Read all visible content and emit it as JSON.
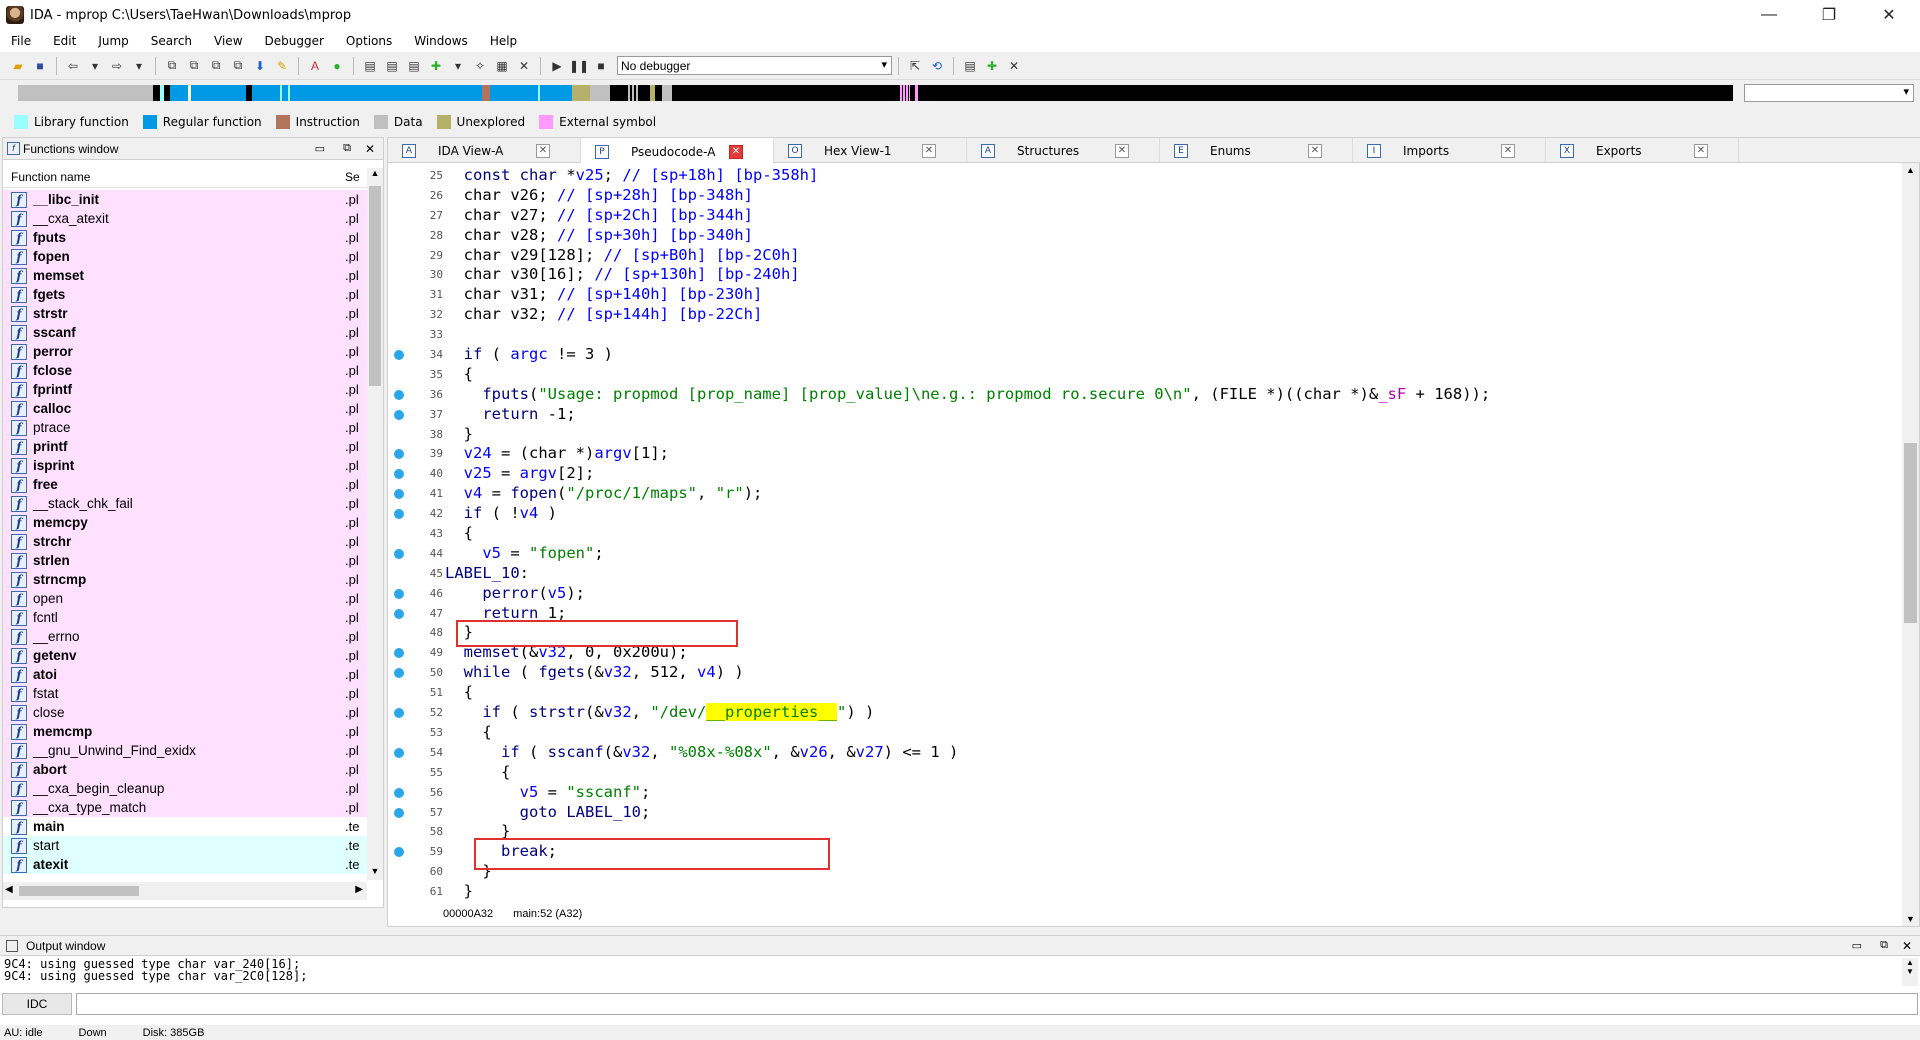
{
  "window": {
    "title": "IDA - mprop C:\\Users\\TaeHwan\\Downloads\\mprop",
    "minimize": "—",
    "restore": "❐",
    "close": "✕"
  },
  "menu": [
    "File",
    "Edit",
    "Jump",
    "Search",
    "View",
    "Debugger",
    "Options",
    "Windows",
    "Help"
  ],
  "toolbar": {
    "debugger_select": "No debugger"
  },
  "legend": [
    {
      "label": "Library function",
      "color": "#99ffff"
    },
    {
      "label": "Regular function",
      "color": "#0099e6"
    },
    {
      "label": "Instruction",
      "color": "#b0755a"
    },
    {
      "label": "Data",
      "color": "#c0c0c0"
    },
    {
      "label": "Unexplored",
      "color": "#b5b06a"
    },
    {
      "label": "External symbol",
      "color": "#ff99ff"
    }
  ],
  "functions_window": {
    "title": "Functions window",
    "col_name": "Function name",
    "col_segment": "Se",
    "rows": [
      {
        "name": "__libc_init",
        "seg": ".pl",
        "bg": "#ffe0ff",
        "bold": true
      },
      {
        "name": "__cxa_atexit",
        "seg": ".pl",
        "bg": "#ffe0ff",
        "bold": false
      },
      {
        "name": "fputs",
        "seg": ".pl",
        "bg": "#ffe0ff",
        "bold": true
      },
      {
        "name": "fopen",
        "seg": ".pl",
        "bg": "#ffe0ff",
        "bold": true
      },
      {
        "name": "memset",
        "seg": ".pl",
        "bg": "#ffe0ff",
        "bold": true
      },
      {
        "name": "fgets",
        "seg": ".pl",
        "bg": "#ffe0ff",
        "bold": true
      },
      {
        "name": "strstr",
        "seg": ".pl",
        "bg": "#ffe0ff",
        "bold": true
      },
      {
        "name": "sscanf",
        "seg": ".pl",
        "bg": "#ffe0ff",
        "bold": true
      },
      {
        "name": "perror",
        "seg": ".pl",
        "bg": "#ffe0ff",
        "bold": true
      },
      {
        "name": "fclose",
        "seg": ".pl",
        "bg": "#ffe0ff",
        "bold": true
      },
      {
        "name": "fprintf",
        "seg": ".pl",
        "bg": "#ffe0ff",
        "bold": true
      },
      {
        "name": "calloc",
        "seg": ".pl",
        "bg": "#ffe0ff",
        "bold": true
      },
      {
        "name": "ptrace",
        "seg": ".pl",
        "bg": "#ffe0ff",
        "bold": false
      },
      {
        "name": "printf",
        "seg": ".pl",
        "bg": "#ffe0ff",
        "bold": true
      },
      {
        "name": "isprint",
        "seg": ".pl",
        "bg": "#ffe0ff",
        "bold": true
      },
      {
        "name": "free",
        "seg": ".pl",
        "bg": "#ffe0ff",
        "bold": true
      },
      {
        "name": "__stack_chk_fail",
        "seg": ".pl",
        "bg": "#ffe0ff",
        "bold": false
      },
      {
        "name": "memcpy",
        "seg": ".pl",
        "bg": "#ffe0ff",
        "bold": true
      },
      {
        "name": "strchr",
        "seg": ".pl",
        "bg": "#ffe0ff",
        "bold": true
      },
      {
        "name": "strlen",
        "seg": ".pl",
        "bg": "#ffe0ff",
        "bold": true
      },
      {
        "name": "strncmp",
        "seg": ".pl",
        "bg": "#ffe0ff",
        "bold": true
      },
      {
        "name": "open",
        "seg": ".pl",
        "bg": "#ffe0ff",
        "bold": false
      },
      {
        "name": "fcntl",
        "seg": ".pl",
        "bg": "#ffe0ff",
        "bold": false
      },
      {
        "name": "__errno",
        "seg": ".pl",
        "bg": "#ffe0ff",
        "bold": false
      },
      {
        "name": "getenv",
        "seg": ".pl",
        "bg": "#ffe0ff",
        "bold": true
      },
      {
        "name": "atoi",
        "seg": ".pl",
        "bg": "#ffe0ff",
        "bold": true
      },
      {
        "name": "fstat",
        "seg": ".pl",
        "bg": "#ffe0ff",
        "bold": false
      },
      {
        "name": "close",
        "seg": ".pl",
        "bg": "#ffe0ff",
        "bold": false
      },
      {
        "name": "memcmp",
        "seg": ".pl",
        "bg": "#ffe0ff",
        "bold": true
      },
      {
        "name": "__gnu_Unwind_Find_exidx",
        "seg": ".pl",
        "bg": "#ffe0ff",
        "bold": false
      },
      {
        "name": "abort",
        "seg": ".pl",
        "bg": "#ffe0ff",
        "bold": true
      },
      {
        "name": "__cxa_begin_cleanup",
        "seg": ".pl",
        "bg": "#ffe0ff",
        "bold": false
      },
      {
        "name": "__cxa_type_match",
        "seg": ".pl",
        "bg": "#ffe0ff",
        "bold": false
      },
      {
        "name": "main",
        "seg": ".te",
        "bg": "#ffffff",
        "bold": true
      },
      {
        "name": "start",
        "seg": ".te",
        "bg": "#e0ffff",
        "bold": false
      },
      {
        "name": "atexit",
        "seg": ".te",
        "bg": "#e0ffff",
        "bold": true
      }
    ]
  },
  "tabs": [
    {
      "label": "IDA View-A",
      "icon": "A"
    },
    {
      "label": "Pseudocode-A",
      "icon": "P"
    },
    {
      "label": "Hex View-1",
      "icon": "O"
    },
    {
      "label": "Structures",
      "icon": "A"
    },
    {
      "label": "Enums",
      "icon": "E"
    },
    {
      "label": "Imports",
      "icon": "I"
    },
    {
      "label": "Exports",
      "icon": "X"
    }
  ],
  "code_lines": [
    {
      "n": "25",
      "bp": false,
      "html": "  <span class=\"kw\">const char</span> *<span class=\"vr\">v25</span>; <span class=\"cm\">// [sp+18h] [bp-358h]</span>"
    },
    {
      "n": "26",
      "bp": false,
      "html": "  char v26; <span class=\"cm\">// [sp+28h] [bp-348h]</span>"
    },
    {
      "n": "27",
      "bp": false,
      "html": "  char v27; <span class=\"cm\">// [sp+2Ch] [bp-344h]</span>"
    },
    {
      "n": "28",
      "bp": false,
      "html": "  char v28; <span class=\"cm\">// [sp+30h] [bp-340h]</span>"
    },
    {
      "n": "29",
      "bp": false,
      "html": "  char v29[128]; <span class=\"cm\">// [sp+B0h] [bp-2C0h]</span>"
    },
    {
      "n": "30",
      "bp": false,
      "html": "  char v30[16]; <span class=\"cm\">// [sp+130h] [bp-240h]</span>"
    },
    {
      "n": "31",
      "bp": false,
      "html": "  char v31; <span class=\"cm\">// [sp+140h] [bp-230h]</span>"
    },
    {
      "n": "32",
      "bp": false,
      "html": "  char v32; <span class=\"cm\">// [sp+144h] [bp-22Ch]</span>"
    },
    {
      "n": "33",
      "bp": false,
      "html": ""
    },
    {
      "n": "34",
      "bp": true,
      "html": "  <span class=\"kw\">if</span> ( <span class=\"vr\">argc</span> != 3 )"
    },
    {
      "n": "35",
      "bp": false,
      "html": "  {"
    },
    {
      "n": "36",
      "bp": true,
      "html": "    <span class=\"kw\">fputs</span>(<span class=\"st\">\"Usage: propmod [prop_name] [prop_value]\\ne.g.: propmod ro.secure 0\\n\"</span>, (FILE *)((char *)&amp;<span class=\"gl\">_sF</span> + 168));"
    },
    {
      "n": "37",
      "bp": true,
      "html": "    <span class=\"kw\">return</span> -1;"
    },
    {
      "n": "38",
      "bp": false,
      "html": "  }"
    },
    {
      "n": "39",
      "bp": true,
      "html": "  <span class=\"vr\">v24</span> = (char *)<span class=\"vr\">argv</span>[1];"
    },
    {
      "n": "40",
      "bp": true,
      "html": "  <span class=\"vr\">v25</span> = <span class=\"vr\">argv</span>[2];"
    },
    {
      "n": "41",
      "bp": true,
      "html": "  <span class=\"vr\">v4</span> = <span class=\"kw\">fopen</span>(<span class=\"st\">\"/proc/1/maps\"</span>, <span class=\"st\">\"r\"</span>);"
    },
    {
      "n": "42",
      "bp": true,
      "html": "  <span class=\"kw\">if</span> ( !<span class=\"vr\">v4</span> )"
    },
    {
      "n": "43",
      "bp": false,
      "html": "  {"
    },
    {
      "n": "44",
      "bp": true,
      "html": "    <span class=\"vr\">v5</span> = <span class=\"st\">\"fopen\"</span>;"
    },
    {
      "n": "45",
      "bp": false,
      "html": "<span class=\"kw\">LABEL_10</span>:"
    },
    {
      "n": "46",
      "bp": true,
      "html": "    <span class=\"kw\">perror</span>(<span class=\"vr\">v5</span>);"
    },
    {
      "n": "47",
      "bp": true,
      "html": "    <span class=\"kw\">return</span> 1;"
    },
    {
      "n": "48",
      "bp": false,
      "html": "  }"
    },
    {
      "n": "49",
      "bp": true,
      "html": "  <span class=\"kw\">memset</span>(&amp;<span class=\"vr\">v32</span>, 0, 0x200u);"
    },
    {
      "n": "50",
      "bp": true,
      "html": "  <span class=\"kw\">while</span> ( <span class=\"kw\">fgets</span>(&amp;<span class=\"vr\">v32</span>, 512, <span class=\"vr\">v4</span>) )"
    },
    {
      "n": "51",
      "bp": false,
      "html": "  {"
    },
    {
      "n": "52",
      "bp": true,
      "html": "    <span class=\"kw\">if</span> ( <span class=\"kw\">strstr</span>(&amp;<span class=\"vr\">v32</span>, <span class=\"st\">\"/dev/<span class=\"hl\">__properties__</span>\"</span>) )"
    },
    {
      "n": "53",
      "bp": false,
      "html": "    {"
    },
    {
      "n": "54",
      "bp": true,
      "html": "      <span class=\"kw\">if</span> ( <span class=\"kw\">sscanf</span>(&amp;<span class=\"vr\">v32</span>, <span class=\"st\">\"%08x-%08x\"</span>, &amp;<span class=\"vr\">v26</span>, &amp;<span class=\"vr\">v27</span>) &lt;= 1 )"
    },
    {
      "n": "55",
      "bp": false,
      "html": "      {"
    },
    {
      "n": "56",
      "bp": true,
      "html": "        <span class=\"vr\">v5</span> = <span class=\"st\">\"sscanf\"</span>;"
    },
    {
      "n": "57",
      "bp": true,
      "html": "        <span class=\"kw\">goto</span> <span class=\"kw\">LABEL_10</span>;"
    },
    {
      "n": "58",
      "bp": false,
      "html": "      }"
    },
    {
      "n": "59",
      "bp": true,
      "html": "      <span class=\"kw\">break</span>;"
    },
    {
      "n": "60",
      "bp": false,
      "html": "    }"
    },
    {
      "n": "61",
      "bp": false,
      "html": "  }"
    }
  ],
  "code_status": {
    "address": "00000A32",
    "location": "main:52 (A32)"
  },
  "output": {
    "title": "Output window",
    "lines": [
      "9C4: using guessed type char var_240[16];",
      "9C4: using guessed type char var_2C0[128];"
    ],
    "idc_label": "IDC"
  },
  "statusbar": {
    "au": "AU:  idle",
    "dir": "Down",
    "disk": "Disk: 385GB"
  }
}
